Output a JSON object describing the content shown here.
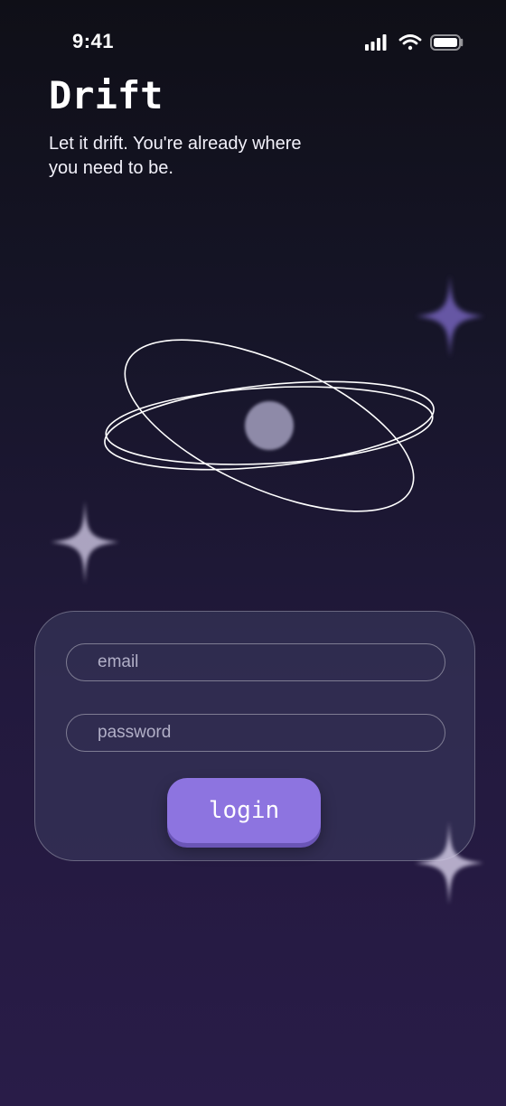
{
  "status_bar": {
    "time": "9:41",
    "icons": [
      "signal-icon",
      "wifi-icon",
      "battery-icon"
    ]
  },
  "header": {
    "title": "Drift",
    "tagline": "Let it drift. You're already where you need to be."
  },
  "illustration": {
    "icon": "orbit-icon"
  },
  "login_form": {
    "email_placeholder": "email",
    "password_placeholder": "password",
    "login_label": "login"
  },
  "colors": {
    "background_top": "#0f0f17",
    "background_bottom": "#291c48",
    "card": "#38385c",
    "accent": "#8d74e0"
  }
}
